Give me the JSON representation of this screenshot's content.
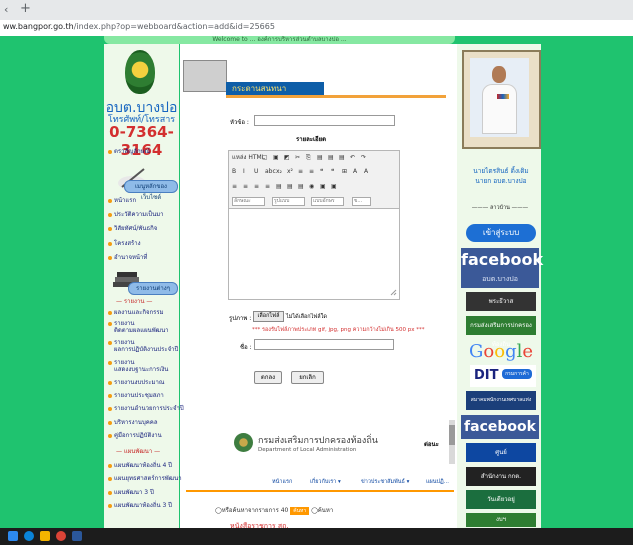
{
  "browser": {
    "back_glyph": "‹",
    "new_tab_glyph": "+",
    "url_domain": "ww.bangpor.go.th",
    "url_path": "/index.php?op=webboard&action=add&id=25665"
  },
  "header": {
    "topnav_text": "Welcome to ... องค์การบริหารส่วนตำบลบางปอ ..."
  },
  "left": {
    "org_name": "อบต.บางปอ",
    "phone_label": "โทรศัพท์/โทรสาร",
    "phone_number": "0-7364-3164",
    "intro_item": "ตราสัญลักษณ์",
    "menu_badge": "เมนูหลักของเว็บไซต์",
    "menu_items": [
      "หน้าแรก",
      "ประวัติความเป็นมา",
      "วิสัยทัศน์/พันธกิจ",
      "โครงสร้าง",
      "อำนาจหน้าที่"
    ],
    "report_badge": "รายงานต่างๆ",
    "section_report": "— รายงาน —",
    "report_items": [
      "ผลงานและกิจกรรม",
      "รายงาน",
      "ติดตามผลแผนพัฒนา",
      "รายงาน",
      "ผลการปฏิบัติงานประจำปี",
      "รายงาน",
      "แสดงงบฐานะการเงิน",
      "รายงานงบประมาณ",
      "รายงานประชุมสภา",
      "รายงานอำนวยการประจำปี",
      "บริหารงานบุคคล",
      "คู่มือการปฏิบัติงาน"
    ],
    "section_plan": "— แผนพัฒนา —",
    "plan_items": [
      "แผนพัฒนาท้องถิ่น 4 ปี",
      "แผนยุทธศาสตร์การพัฒนา",
      "แผนพัฒนา 3 ปี",
      "แผนพัฒนาท้องถิ่น 3 ปี"
    ]
  },
  "main": {
    "banner_title": "กระดานสนทนา",
    "subject_label": "หัวข้อ :",
    "detail_label": "รายละเอียด",
    "editor": {
      "row1": [
        "แหล่ง HTML",
        "▢",
        "▣",
        "◩",
        "✂",
        "⎘",
        "▤",
        "▤",
        "▤",
        "↶",
        "↷"
      ],
      "row2": [
        "B",
        "I",
        "U",
        "abc",
        "x₂",
        "x²",
        "≡",
        "≡",
        "❝",
        "❝",
        "⊞",
        "A",
        "A"
      ],
      "row3": [
        "≡",
        "≡",
        "≡",
        "≡",
        "▤",
        "▤",
        "▤",
        "◉",
        "▣",
        "▣"
      ],
      "style_placeholder": "ลักษณะ",
      "format_placeholder": "รูปแบบ",
      "font_placeholder": "แบบอักษร",
      "size_placeholder": "ข..."
    },
    "image_label": "รูปภาพ :",
    "file_button": "เลือกไฟล์",
    "file_status": "ไม่ได้เลือกไฟล์ใด",
    "upload_warning": "*** รองรับไฟล์ภาพประเภท gif, jpg, png ความกว้างไม่เกิน 500 px ***",
    "name_label": "ชื่อ :",
    "submit_button": "ตกลง",
    "cancel_button": "ยกเลิก",
    "dept_name_th": "กรมส่งเสริมการปกครองท้องถิ่น",
    "dept_name_en": "Department of Local Administration",
    "dept_more": "ต่อนะ",
    "subnav": [
      "หน้าแรก",
      "เกี่ยวกับเรา ▾",
      "ข่าวประชาสัมพันธ์ ▾",
      "แผนปฏิ..."
    ],
    "search_option_1": "หรือค้นหาจากรายการ 40",
    "search_go": "ค้นหา",
    "search_option_2": "ค้นหา",
    "bottom_heading": "หนังสือราชการ สถ."
  },
  "right": {
    "person_name": "นายไตรสินธ์  ติ้งเติม",
    "person_title": "นายก อบต.บางปอ",
    "link_select": "——— ลาวบ้าน ———",
    "login_button": "เข้าสู่ระบบ",
    "fb_title": "facebook",
    "fb_sub": "อบต.บางปอ",
    "banners": [
      "พระธีวาส",
      "กรมส่งเสริมการปกครองท้องถิ่น",
      "Google",
      "DIT",
      "สมาคมพนักงานเทศบาลแห่งประเทศไทย",
      "facebook",
      "ศูนย์",
      "สำนักงาน กกต.",
      "วันเดียวอยู่",
      "งบฯ"
    ],
    "dit_badge": "กรมการค้า"
  },
  "colors": {
    "page_green": "#1fc36f",
    "nav_blue": "#1565c0",
    "phone_red": "#d32f2f",
    "banner_blue": "#0e5ea8",
    "facebook_blue": "#3b5998",
    "accent_orange": "#ff9800"
  },
  "taskbar": {
    "icons": [
      "windows-icon",
      "edge-icon",
      "folder-icon",
      "chrome-icon",
      "word-icon"
    ]
  }
}
